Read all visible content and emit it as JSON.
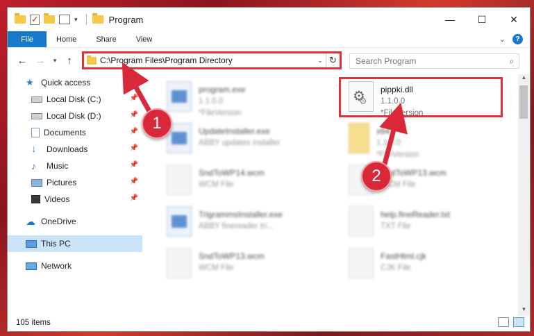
{
  "window": {
    "title": "Program",
    "controls": {
      "minimize": "—",
      "maximize": "☐",
      "close": "✕"
    }
  },
  "ribbon": {
    "tabs": [
      "File",
      "Home",
      "Share",
      "View"
    ],
    "help": "?"
  },
  "navigation": {
    "address": "C:\\Program Files\\Program Directory",
    "search_placeholder": "Search Program"
  },
  "sidebar": {
    "items": [
      {
        "label": "Quick access",
        "icon": "star-icon",
        "pinned": false
      },
      {
        "label": "Local Disk (C:)",
        "icon": "drive-icon",
        "pinned": true
      },
      {
        "label": "Local Disk (D:)",
        "icon": "drive-icon",
        "pinned": true
      },
      {
        "label": "Documents",
        "icon": "documents-icon",
        "pinned": true
      },
      {
        "label": "Downloads",
        "icon": "download-icon",
        "pinned": true
      },
      {
        "label": "Music",
        "icon": "music-icon",
        "pinned": true
      },
      {
        "label": "Pictures",
        "icon": "pictures-icon",
        "pinned": true
      },
      {
        "label": "Videos",
        "icon": "videos-icon",
        "pinned": true
      },
      {
        "label": "OneDrive",
        "icon": "cloud-icon",
        "pinned": false
      },
      {
        "label": "This PC",
        "icon": "pc-icon",
        "pinned": false,
        "selected": true
      },
      {
        "label": "Network",
        "icon": "network-icon",
        "pinned": false
      }
    ]
  },
  "files": [
    {
      "name": "program.exe",
      "line2": "1.1.0.0",
      "line3": "*FileVersion",
      "icon": "exe-icon"
    },
    {
      "name": "pippki.dll",
      "line2": "1.1.0.0",
      "line3": "*FileVersion",
      "icon": "dll-gear-icon",
      "highlighted": true
    },
    {
      "name": "UpdateInstaller.exe",
      "line2": "ABBY updates installer",
      "line3": "",
      "icon": "exe-icon"
    },
    {
      "name": "x64",
      "line2": "1.1.0.0",
      "line3": "*FileVersion",
      "icon": "folder-icon"
    },
    {
      "name": "SndToWP14.wcm",
      "line2": "WCM File",
      "line3": "",
      "icon": "file-icon"
    },
    {
      "name": "SndToWP13.wcm",
      "line2": "WCM File",
      "line3": "",
      "icon": "file-icon"
    },
    {
      "name": "TrigrammsInstaller.exe",
      "line2": "ABBY finereader tri...",
      "line3": "",
      "icon": "exe-icon"
    },
    {
      "name": "help.fineReader.txt",
      "line2": "TXT File",
      "line3": "",
      "icon": "file-icon"
    },
    {
      "name": "SndToWP13.wcm",
      "line2": "WCM File",
      "line3": "",
      "icon": "file-icon"
    },
    {
      "name": "FastHtml.cjk",
      "line2": "CJK File",
      "line3": "",
      "icon": "file-icon"
    }
  ],
  "status": {
    "item_count": "105 items"
  },
  "annotations": {
    "callout1": "1",
    "callout2": "2"
  },
  "colors": {
    "accent": "#1979ca",
    "highlight": "#e0303a",
    "selection": "#cce4f7"
  }
}
